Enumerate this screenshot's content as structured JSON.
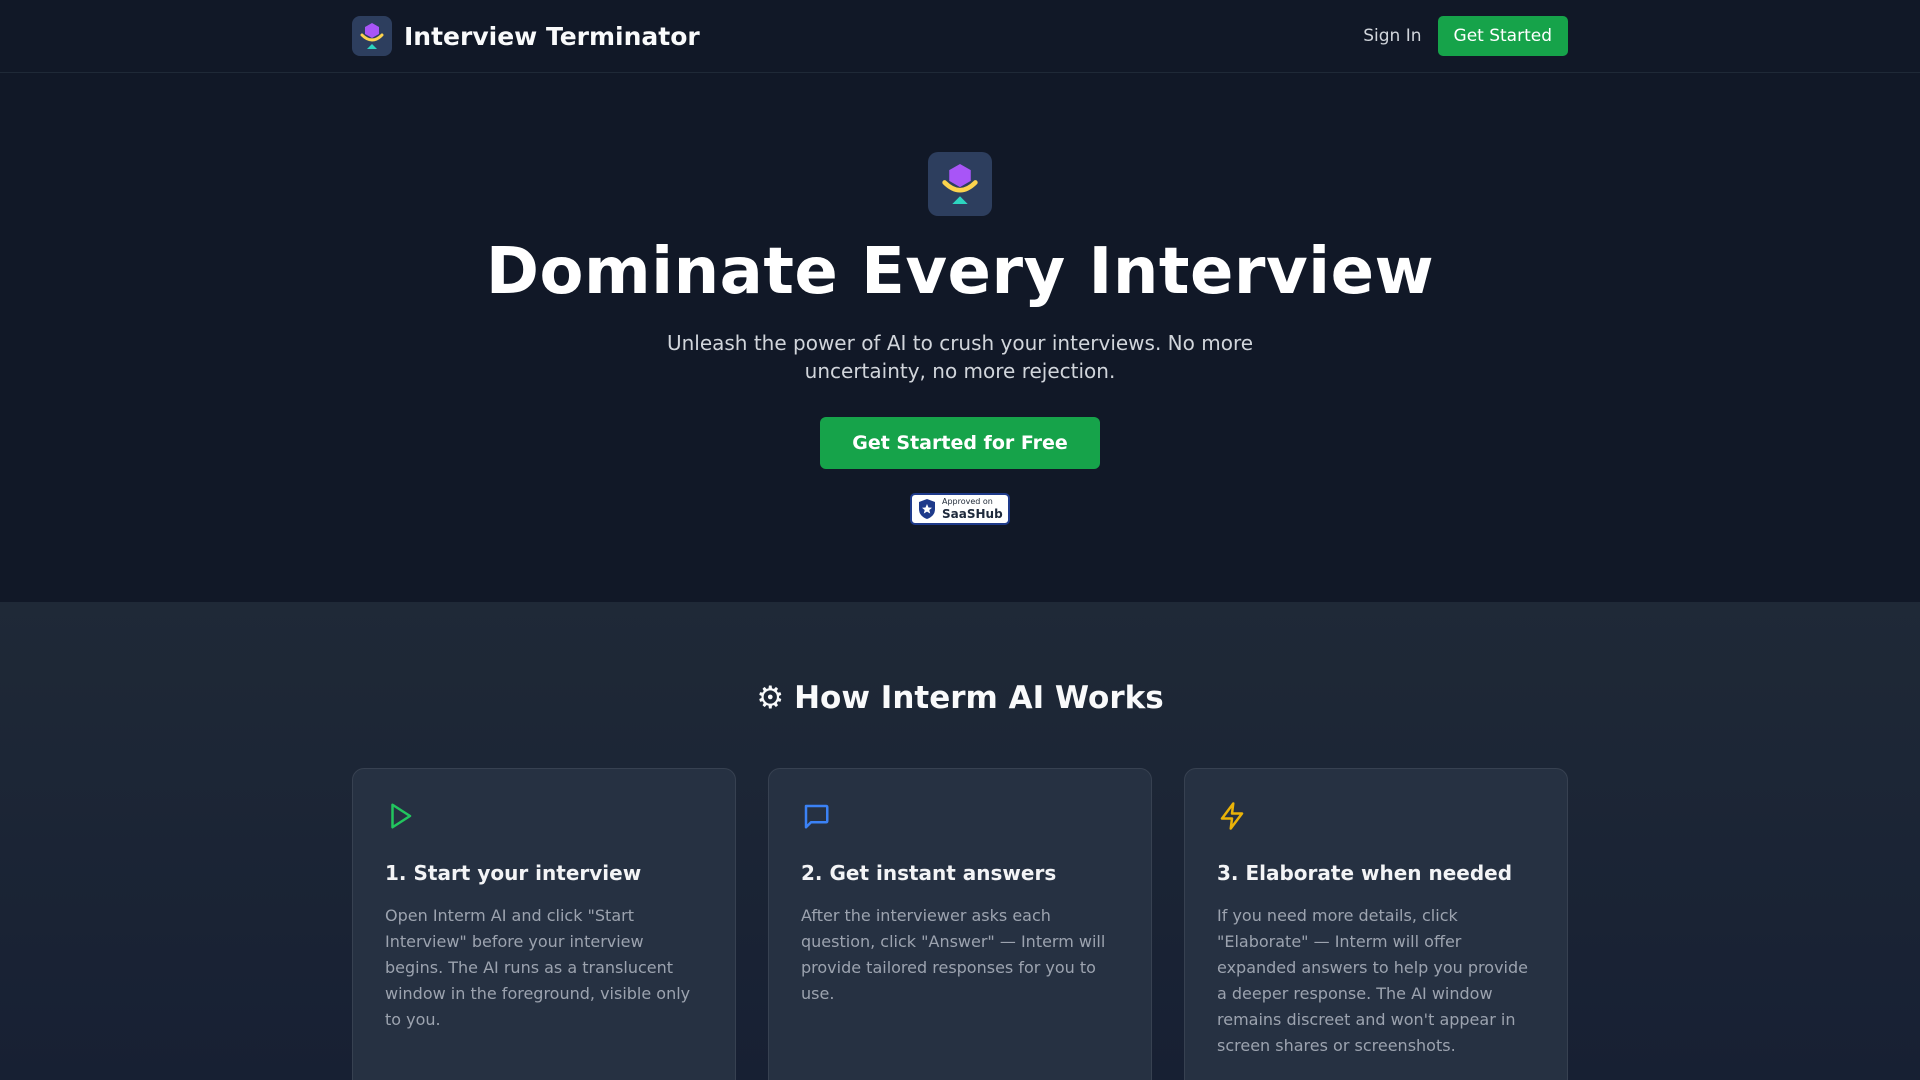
{
  "header": {
    "brand_name": "Interview Terminator",
    "sign_in_label": "Sign In",
    "get_started_label": "Get Started"
  },
  "hero": {
    "title": "Dominate Every Interview",
    "subtitle": "Unleash the power of AI to crush your interviews. No more uncertainty, no more rejection.",
    "cta_label": "Get Started for Free",
    "badge": {
      "small_text": "Approved on",
      "big_text": "SaaSHub"
    }
  },
  "how": {
    "icon": "⚙",
    "title": "How Interm AI Works",
    "cards": [
      {
        "icon": "play-icon",
        "icon_color": "#22c55e",
        "title": "1. Start your interview",
        "body": "Open Interm AI and click \"Start Interview\" before your interview begins. The AI runs as a translucent window in the foreground, visible only to you."
      },
      {
        "icon": "chat-icon",
        "icon_color": "#3b82f6",
        "title": "2. Get instant answers",
        "body": "After the interviewer asks each question, click \"Answer\" — Interm will provide tailored responses for you to use."
      },
      {
        "icon": "lightning-icon",
        "icon_color": "#eab308",
        "title": "3. Elaborate when needed",
        "body": "If you need more details, click \"Elaborate\" — Interm will offer expanded answers to help you provide a deeper response. The AI window remains discreet and won't appear in screen shares or screenshots."
      }
    ]
  },
  "colors": {
    "background": "#111827",
    "accent": "#16a34a",
    "section_bg": "#1f2937"
  }
}
